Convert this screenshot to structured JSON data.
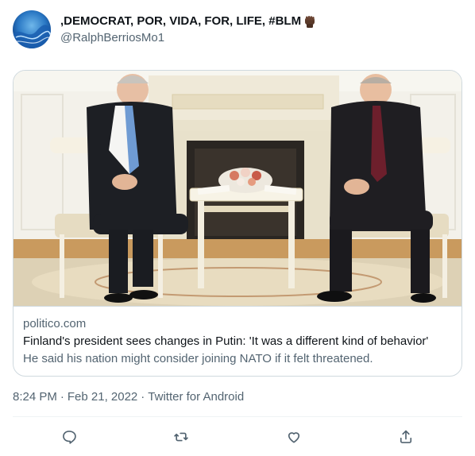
{
  "author": {
    "display_name": ",DEMOCRAT, POR, VIDA, FOR, LIFE, #BLM",
    "handle": "@RalphBerriosMo1",
    "emoji_icon": "raised-fist-icon"
  },
  "card": {
    "domain": "politico.com",
    "title": "Finland's president sees changes in Putin: 'It was a different kind of behavior'",
    "description": "He said his nation might consider joining NATO if it felt threatened."
  },
  "meta": {
    "time": "8:24 PM",
    "separator": "·",
    "date": "Feb 21, 2022",
    "source": "Twitter for Android"
  },
  "actions": [
    {
      "name": "reply",
      "icon": "reply-icon"
    },
    {
      "name": "retweet",
      "icon": "retweet-icon"
    },
    {
      "name": "like",
      "icon": "heart-icon"
    },
    {
      "name": "share",
      "icon": "share-icon"
    }
  ],
  "colors": {
    "text": "#0f1419",
    "secondary": "#536471",
    "border": "#cfd9de",
    "divider": "#eff3f4"
  }
}
